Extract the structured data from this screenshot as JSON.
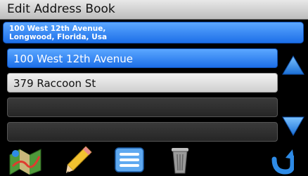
{
  "header": {
    "title": "Edit Address Book"
  },
  "selected_address": {
    "line1": "100 West 12th Avenue,",
    "line2": "Longwood, Florida, Usa"
  },
  "list": {
    "items": [
      {
        "label": "100 West 12th Avenue",
        "state": "selected"
      },
      {
        "label": "379 Raccoon St",
        "state": "normal"
      },
      {
        "label": "",
        "state": "empty"
      },
      {
        "label": "",
        "state": "empty"
      }
    ]
  },
  "toolbar": {
    "icons": [
      "map-route-icon",
      "pencil-icon",
      "details-list-icon",
      "trash-can-icon",
      "back-arrow-icon"
    ]
  },
  "colors": {
    "accent_blue": "#1d6fe8",
    "arrow_blue": "#2e8be6",
    "background": "#000000"
  }
}
